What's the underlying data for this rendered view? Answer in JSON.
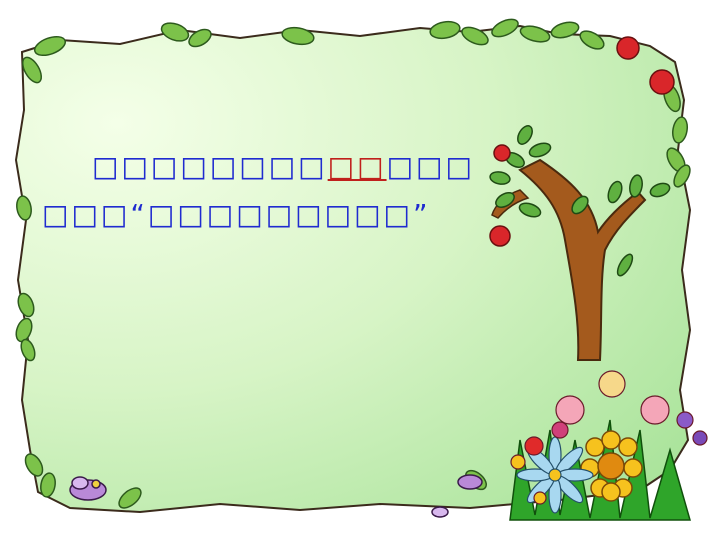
{
  "slide": {
    "line1_before": "□□□□□□□□",
    "line1_highlight": "□□",
    "line1_after": "□□□",
    "line2_prefix": "□□□",
    "quote_open": "“",
    "line2_quoted": "□□□□□□□□□",
    "quote_close": "”"
  },
  "colors": {
    "text_main": "#1f2bd0",
    "text_highlight": "#c0201c",
    "panel_light": "#f4ffe8",
    "panel_dark": "#a9e39a",
    "leaf_green": "#4fa43a",
    "trunk_brown": "#a45a1d",
    "apple_red": "#d9262a"
  }
}
